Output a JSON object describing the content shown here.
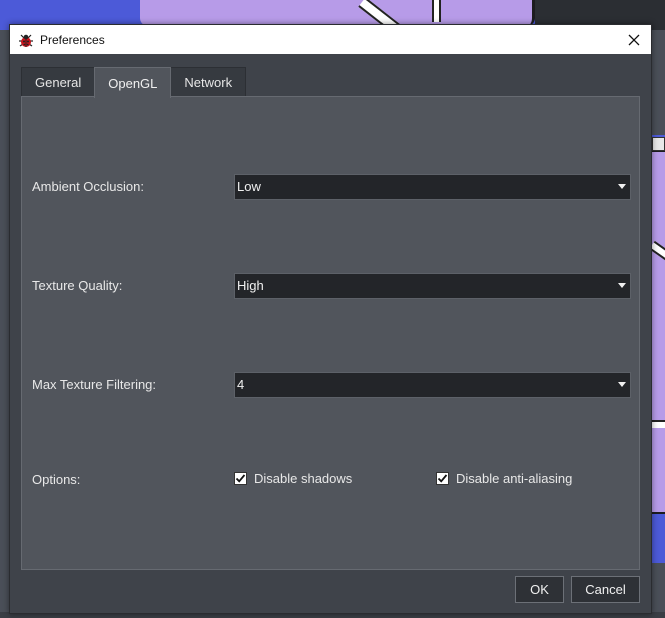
{
  "window": {
    "title": "Preferences"
  },
  "tabs": [
    {
      "label": "General",
      "active": false
    },
    {
      "label": "OpenGL",
      "active": true
    },
    {
      "label": "Network",
      "active": false
    }
  ],
  "settings": {
    "ambient_occlusion": {
      "label": "Ambient Occlusion:",
      "value": "Low"
    },
    "texture_quality": {
      "label": "Texture Quality:",
      "value": "High"
    },
    "max_texture_filtering": {
      "label": "Max Texture Filtering:",
      "value": "4"
    },
    "options": {
      "label": "Options:",
      "disable_shadows": {
        "label": "Disable shadows",
        "checked": true
      },
      "disable_antialiasing": {
        "label": "Disable anti-aliasing",
        "checked": true
      }
    }
  },
  "buttons": {
    "ok": "OK",
    "cancel": "Cancel"
  },
  "colors": {
    "dialog_bg": "#3f434a",
    "panel_bg": "#51555c",
    "combo_bg": "#232529",
    "background_blue": "#4c5ad8",
    "background_purple": "#b79be8"
  },
  "icons": {
    "app": "ladybug-icon",
    "close": "close-icon",
    "combo_arrow": "chevron-down-icon",
    "checkbox": "checkmark-icon"
  }
}
